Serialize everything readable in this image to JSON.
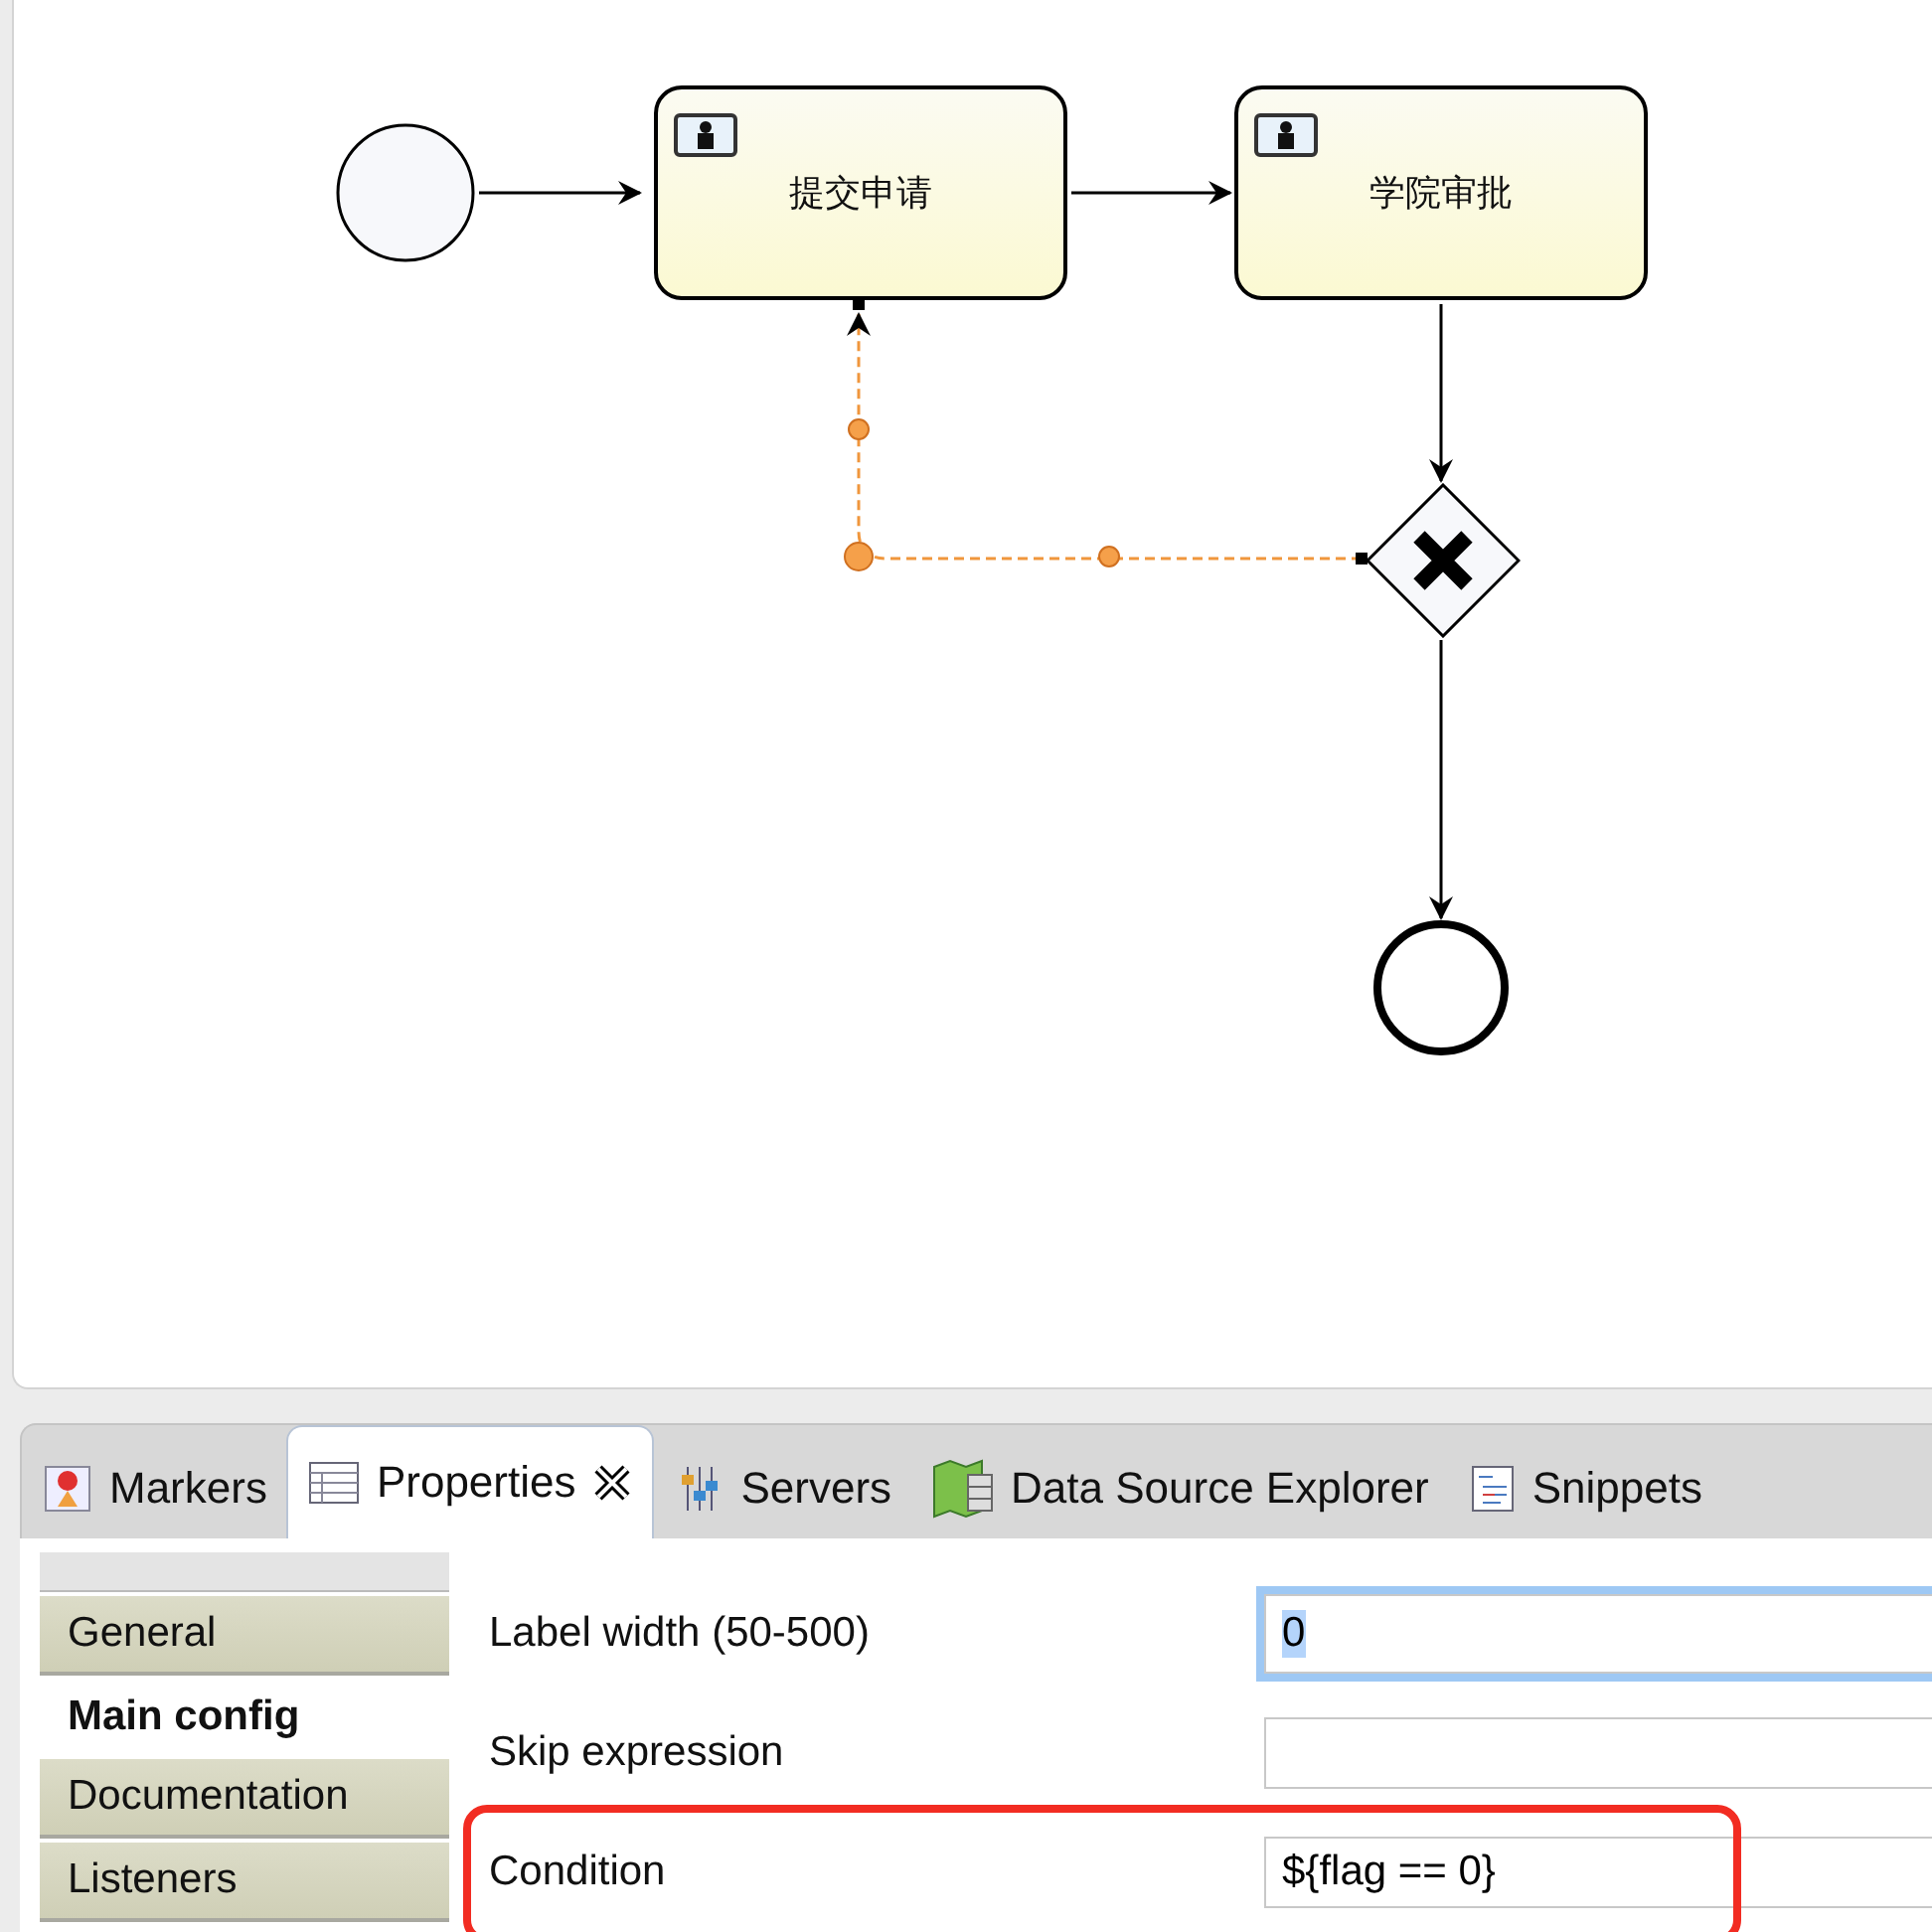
{
  "diagram": {
    "nodes": [
      {
        "kind": "start"
      },
      {
        "kind": "task",
        "label": "提交申请"
      },
      {
        "kind": "task",
        "label": "学院审批"
      },
      {
        "kind": "gateway"
      },
      {
        "kind": "end"
      }
    ],
    "selected_flow": {
      "selected": true
    }
  },
  "tabs": [
    {
      "label": "Markers",
      "selected": false
    },
    {
      "label": "Properties",
      "selected": true
    },
    {
      "label": "Servers",
      "selected": false
    },
    {
      "label": "Data Source Explorer",
      "selected": false
    },
    {
      "label": "Snippets",
      "selected": false
    }
  ],
  "sections": [
    {
      "label": "General",
      "selected": false
    },
    {
      "label": "Main config",
      "selected": true
    },
    {
      "label": "Documentation",
      "selected": false
    },
    {
      "label": "Listeners",
      "selected": false
    }
  ],
  "fields": [
    {
      "label": "Label width (50-500)",
      "value": "0",
      "focused": true,
      "highlighted": false
    },
    {
      "label": "Skip expression",
      "focused": false,
      "highlighted": false
    },
    {
      "label": "Condition",
      "value": "${flag == 0}",
      "focused": false,
      "highlighted": true
    }
  ]
}
